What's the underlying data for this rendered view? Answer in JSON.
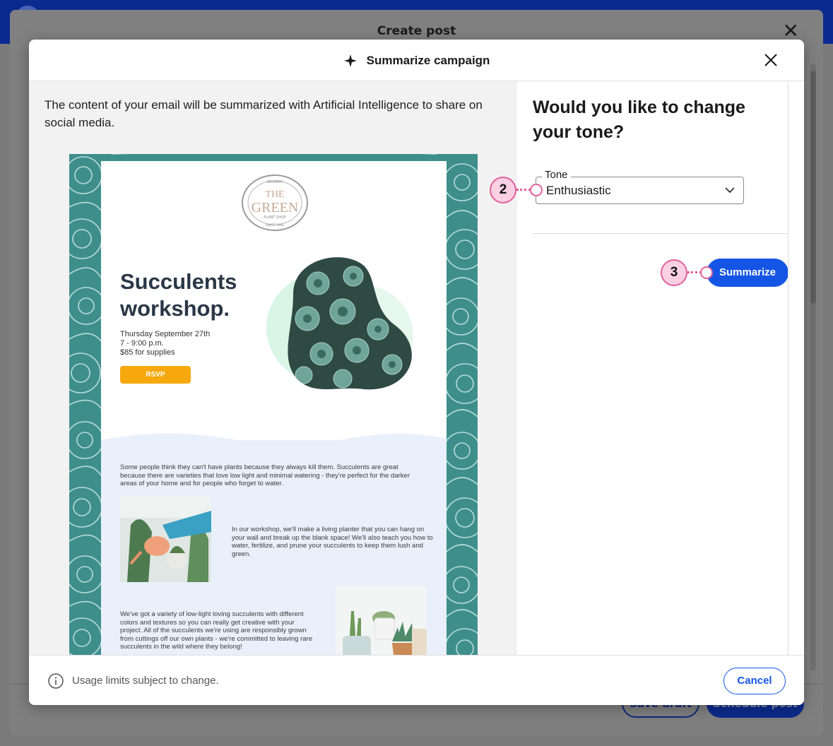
{
  "background": {
    "dialog_title": "Create post",
    "save_draft_label": "Save draft",
    "schedule_post_label": "Schedule post"
  },
  "modal": {
    "title": "Summarize campaign",
    "intro": "The content of your email will be summarized with Artificial Intelligence to share on social media.",
    "tone_heading": "Would you like to change your tone?",
    "tone_label": "Tone",
    "tone_value": "Enthusiastic",
    "summarize_label": "Summarize",
    "usage_note": "Usage limits subject to change.",
    "cancel_label": "Cancel"
  },
  "callouts": {
    "tone": "2",
    "summarize": "3"
  },
  "email": {
    "logo_top": "ORGANIC",
    "logo_line1": "THE",
    "logo_line2": "GREEN",
    "logo_sub": "PLANT SHOP",
    "logo_since": "SINCE 1985",
    "heading_line1": "Succulents",
    "heading_line2": "workshop.",
    "date": "Thursday September 27th",
    "time": "7 - 9:00 p.m.",
    "price": "$85 for supplies",
    "rsvp": "RSVP",
    "para1": "Some people think they can't have plants because they always kill them. Succulents are great because there are varieties that love low light and minimal watering - they're perfect for the darker areas of your home and for people who forget to water.",
    "para2": "In our workshop, we'll make a living planter that you can hang on your wall and break up the blank space! We'll also teach you how to water, fertilize, and prune your succulents to keep them lush and green.",
    "para3": "We've got a variety of low-light loving succulents with different colors and textures so you can really get creative with your project. All of the succulents we're using are responsibly grown from cuttings off our own plants - we're committed to leaving rare succulents in the wild where they belong!"
  },
  "colors": {
    "primary": "#1455e6",
    "callout": "#e0619b",
    "rsvp": "#f6a80d",
    "teal": "#3e8f8c"
  }
}
